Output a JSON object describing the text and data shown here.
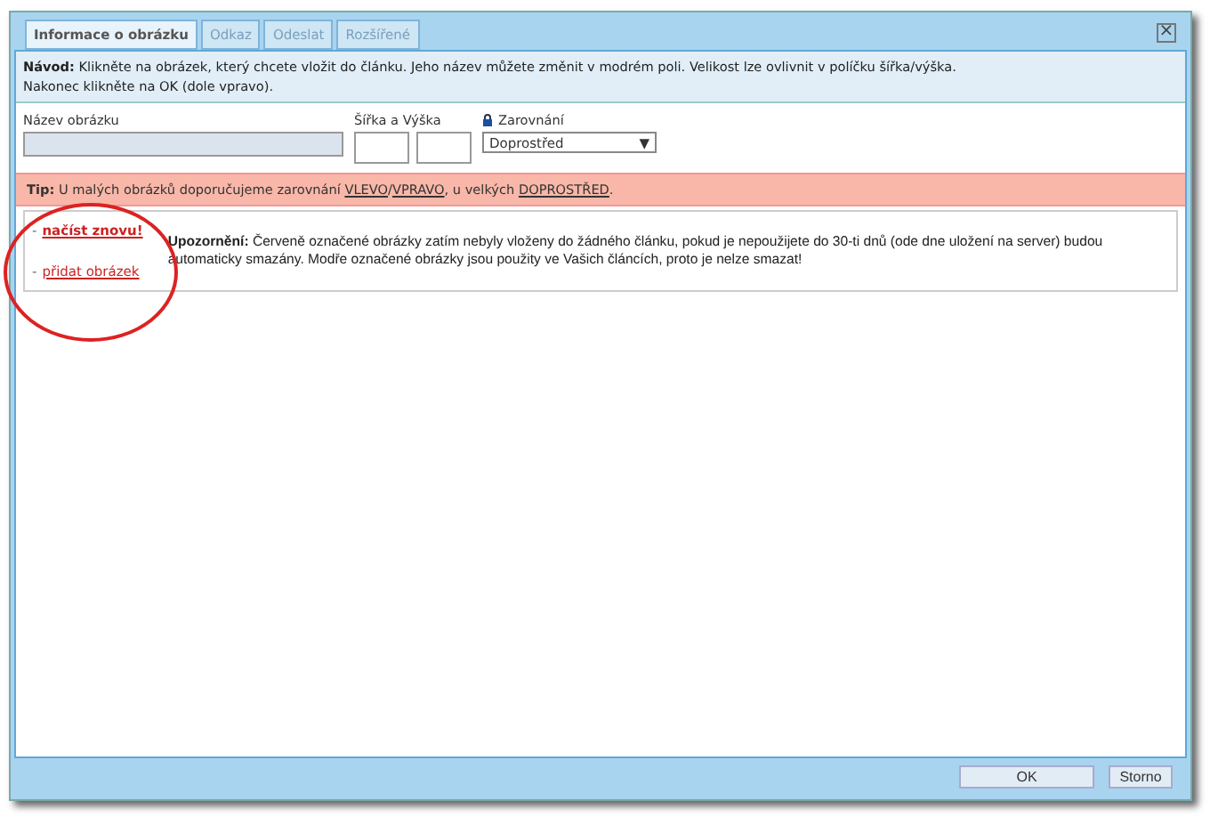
{
  "tabs": [
    {
      "label": "Informace o obrázku",
      "selected": true
    },
    {
      "label": "Odkaz",
      "selected": false
    },
    {
      "label": "Odeslat",
      "selected": false
    },
    {
      "label": "Rozšířené",
      "selected": false
    }
  ],
  "close": "×",
  "guide": "**Návod:** Klikněte na obrázek, který chcete vložit do článku. Jeho název můžete změnit v modrém poli. Velikost lze ovlivnit v políčku šířka/výška.",
  "guide_line2": "Nakonec klikněte na OK (dole vpravo).",
  "form": {
    "name_label": "Název obrázku",
    "size_label": "Šířka a Výška",
    "align_label": "Zarovnání",
    "align_value": "Doprostřed",
    "caret": "▼"
  },
  "tip": [
    {
      "kind": "bold",
      "text": "Tip:"
    },
    {
      "kind": "text",
      "text": " U malých obrázků doporučujeme zarovnání "
    },
    {
      "kind": "link",
      "text": "VLEVO"
    },
    {
      "kind": "text",
      "text": "/"
    },
    {
      "kind": "link",
      "text": "VPRAVO"
    },
    {
      "kind": "text",
      "text": ", u velkých "
    },
    {
      "kind": "link",
      "text": "DOPROSTŘED"
    },
    {
      "kind": "text",
      "text": "."
    }
  ],
  "actions": [
    {
      "kind": "bold",
      "bullet": "-",
      "text": "načíst znovu!"
    },
    {
      "kind": "plain",
      "bullet": "-",
      "text": "přidat obrázek"
    }
  ],
  "warning": "**Upozornění:** Červeně označené obrázky zatím nebyly vloženy do žádného článku, pokud je nepoužijete do 30-ti dnů (ode dne uložení na server) budou automaticky smazány. Modře označené obrázky jsou použity ve Vašich článcích, proto je nelze smazat!",
  "buttons": [
    "OK",
    "Storno"
  ]
}
